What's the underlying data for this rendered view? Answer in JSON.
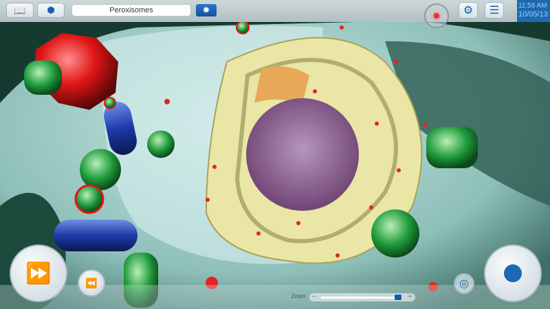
{
  "topbar": {
    "search_value": "Peroxisomes",
    "clock_time": "11:56 AM",
    "clock_date": "10/05/13"
  },
  "icons": {
    "book": "book-icon",
    "cube": "cube-icon",
    "light": "light-icon",
    "record": "record-icon",
    "settings": "gear-icon",
    "menu": "menu-icon",
    "play": "fast-forward-icon",
    "rewind": "rewind-icon",
    "target": "target-icon",
    "action": "circle-icon"
  },
  "zoom": {
    "label": "Zoom",
    "minus": "−",
    "plus": "+",
    "value_percent": 95
  },
  "colors": {
    "accent": "#1d6ab2",
    "record": "#f02b3a"
  }
}
